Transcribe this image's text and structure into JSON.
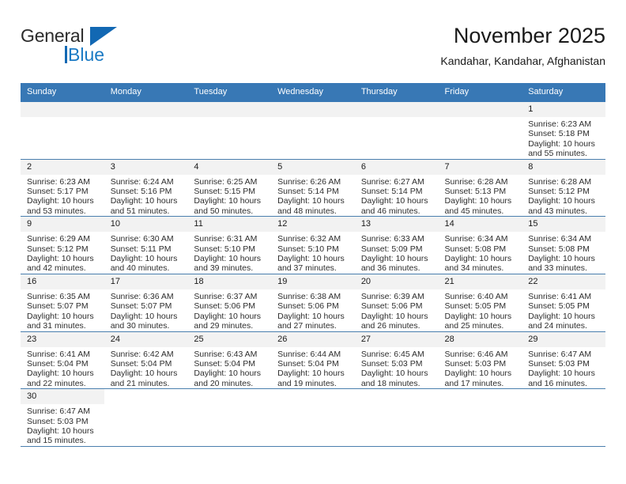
{
  "brand": {
    "name_top": "General",
    "name_bottom": "Blue",
    "flag_icon": "blue-triangle-flag-icon",
    "color_blue": "#1a7ac4",
    "color_dark": "#2b2b2b"
  },
  "header": {
    "title": "November 2025",
    "subtitle": "Kandahar, Kandahar, Afghanistan"
  },
  "theme": {
    "header_row_bg": "#3878b5",
    "header_row_text": "#ffffff",
    "daynum_bg": "#f2f2f2",
    "grid_line": "#3878b5"
  },
  "calendar": {
    "weekday_headers": [
      "Sunday",
      "Monday",
      "Tuesday",
      "Wednesday",
      "Thursday",
      "Friday",
      "Saturday"
    ],
    "labels": {
      "sunrise": "Sunrise:",
      "sunset": "Sunset:",
      "daylight": "Daylight:"
    },
    "weeks": [
      [
        {
          "day": "",
          "blank": true
        },
        {
          "day": "",
          "blank": true
        },
        {
          "day": "",
          "blank": true
        },
        {
          "day": "",
          "blank": true
        },
        {
          "day": "",
          "blank": true
        },
        {
          "day": "",
          "blank": true
        },
        {
          "day": "1",
          "sunrise": "Sunrise: 6:23 AM",
          "sunset": "Sunset: 5:18 PM",
          "daylight1": "Daylight: 10 hours",
          "daylight2": "and 55 minutes."
        }
      ],
      [
        {
          "day": "2",
          "sunrise": "Sunrise: 6:23 AM",
          "sunset": "Sunset: 5:17 PM",
          "daylight1": "Daylight: 10 hours",
          "daylight2": "and 53 minutes."
        },
        {
          "day": "3",
          "sunrise": "Sunrise: 6:24 AM",
          "sunset": "Sunset: 5:16 PM",
          "daylight1": "Daylight: 10 hours",
          "daylight2": "and 51 minutes."
        },
        {
          "day": "4",
          "sunrise": "Sunrise: 6:25 AM",
          "sunset": "Sunset: 5:15 PM",
          "daylight1": "Daylight: 10 hours",
          "daylight2": "and 50 minutes."
        },
        {
          "day": "5",
          "sunrise": "Sunrise: 6:26 AM",
          "sunset": "Sunset: 5:14 PM",
          "daylight1": "Daylight: 10 hours",
          "daylight2": "and 48 minutes."
        },
        {
          "day": "6",
          "sunrise": "Sunrise: 6:27 AM",
          "sunset": "Sunset: 5:14 PM",
          "daylight1": "Daylight: 10 hours",
          "daylight2": "and 46 minutes."
        },
        {
          "day": "7",
          "sunrise": "Sunrise: 6:28 AM",
          "sunset": "Sunset: 5:13 PM",
          "daylight1": "Daylight: 10 hours",
          "daylight2": "and 45 minutes."
        },
        {
          "day": "8",
          "sunrise": "Sunrise: 6:28 AM",
          "sunset": "Sunset: 5:12 PM",
          "daylight1": "Daylight: 10 hours",
          "daylight2": "and 43 minutes."
        }
      ],
      [
        {
          "day": "9",
          "sunrise": "Sunrise: 6:29 AM",
          "sunset": "Sunset: 5:12 PM",
          "daylight1": "Daylight: 10 hours",
          "daylight2": "and 42 minutes."
        },
        {
          "day": "10",
          "sunrise": "Sunrise: 6:30 AM",
          "sunset": "Sunset: 5:11 PM",
          "daylight1": "Daylight: 10 hours",
          "daylight2": "and 40 minutes."
        },
        {
          "day": "11",
          "sunrise": "Sunrise: 6:31 AM",
          "sunset": "Sunset: 5:10 PM",
          "daylight1": "Daylight: 10 hours",
          "daylight2": "and 39 minutes."
        },
        {
          "day": "12",
          "sunrise": "Sunrise: 6:32 AM",
          "sunset": "Sunset: 5:10 PM",
          "daylight1": "Daylight: 10 hours",
          "daylight2": "and 37 minutes."
        },
        {
          "day": "13",
          "sunrise": "Sunrise: 6:33 AM",
          "sunset": "Sunset: 5:09 PM",
          "daylight1": "Daylight: 10 hours",
          "daylight2": "and 36 minutes."
        },
        {
          "day": "14",
          "sunrise": "Sunrise: 6:34 AM",
          "sunset": "Sunset: 5:08 PM",
          "daylight1": "Daylight: 10 hours",
          "daylight2": "and 34 minutes."
        },
        {
          "day": "15",
          "sunrise": "Sunrise: 6:34 AM",
          "sunset": "Sunset: 5:08 PM",
          "daylight1": "Daylight: 10 hours",
          "daylight2": "and 33 minutes."
        }
      ],
      [
        {
          "day": "16",
          "sunrise": "Sunrise: 6:35 AM",
          "sunset": "Sunset: 5:07 PM",
          "daylight1": "Daylight: 10 hours",
          "daylight2": "and 31 minutes."
        },
        {
          "day": "17",
          "sunrise": "Sunrise: 6:36 AM",
          "sunset": "Sunset: 5:07 PM",
          "daylight1": "Daylight: 10 hours",
          "daylight2": "and 30 minutes."
        },
        {
          "day": "18",
          "sunrise": "Sunrise: 6:37 AM",
          "sunset": "Sunset: 5:06 PM",
          "daylight1": "Daylight: 10 hours",
          "daylight2": "and 29 minutes."
        },
        {
          "day": "19",
          "sunrise": "Sunrise: 6:38 AM",
          "sunset": "Sunset: 5:06 PM",
          "daylight1": "Daylight: 10 hours",
          "daylight2": "and 27 minutes."
        },
        {
          "day": "20",
          "sunrise": "Sunrise: 6:39 AM",
          "sunset": "Sunset: 5:06 PM",
          "daylight1": "Daylight: 10 hours",
          "daylight2": "and 26 minutes."
        },
        {
          "day": "21",
          "sunrise": "Sunrise: 6:40 AM",
          "sunset": "Sunset: 5:05 PM",
          "daylight1": "Daylight: 10 hours",
          "daylight2": "and 25 minutes."
        },
        {
          "day": "22",
          "sunrise": "Sunrise: 6:41 AM",
          "sunset": "Sunset: 5:05 PM",
          "daylight1": "Daylight: 10 hours",
          "daylight2": "and 24 minutes."
        }
      ],
      [
        {
          "day": "23",
          "sunrise": "Sunrise: 6:41 AM",
          "sunset": "Sunset: 5:04 PM",
          "daylight1": "Daylight: 10 hours",
          "daylight2": "and 22 minutes."
        },
        {
          "day": "24",
          "sunrise": "Sunrise: 6:42 AM",
          "sunset": "Sunset: 5:04 PM",
          "daylight1": "Daylight: 10 hours",
          "daylight2": "and 21 minutes."
        },
        {
          "day": "25",
          "sunrise": "Sunrise: 6:43 AM",
          "sunset": "Sunset: 5:04 PM",
          "daylight1": "Daylight: 10 hours",
          "daylight2": "and 20 minutes."
        },
        {
          "day": "26",
          "sunrise": "Sunrise: 6:44 AM",
          "sunset": "Sunset: 5:04 PM",
          "daylight1": "Daylight: 10 hours",
          "daylight2": "and 19 minutes."
        },
        {
          "day": "27",
          "sunrise": "Sunrise: 6:45 AM",
          "sunset": "Sunset: 5:03 PM",
          "daylight1": "Daylight: 10 hours",
          "daylight2": "and 18 minutes."
        },
        {
          "day": "28",
          "sunrise": "Sunrise: 6:46 AM",
          "sunset": "Sunset: 5:03 PM",
          "daylight1": "Daylight: 10 hours",
          "daylight2": "and 17 minutes."
        },
        {
          "day": "29",
          "sunrise": "Sunrise: 6:47 AM",
          "sunset": "Sunset: 5:03 PM",
          "daylight1": "Daylight: 10 hours",
          "daylight2": "and 16 minutes."
        }
      ],
      [
        {
          "day": "30",
          "sunrise": "Sunrise: 6:47 AM",
          "sunset": "Sunset: 5:03 PM",
          "daylight1": "Daylight: 10 hours",
          "daylight2": "and 15 minutes."
        },
        {
          "day": "",
          "nodata": true
        },
        {
          "day": "",
          "nodata": true
        },
        {
          "day": "",
          "nodata": true
        },
        {
          "day": "",
          "nodata": true
        },
        {
          "day": "",
          "nodata": true
        },
        {
          "day": "",
          "nodata": true
        }
      ]
    ]
  }
}
